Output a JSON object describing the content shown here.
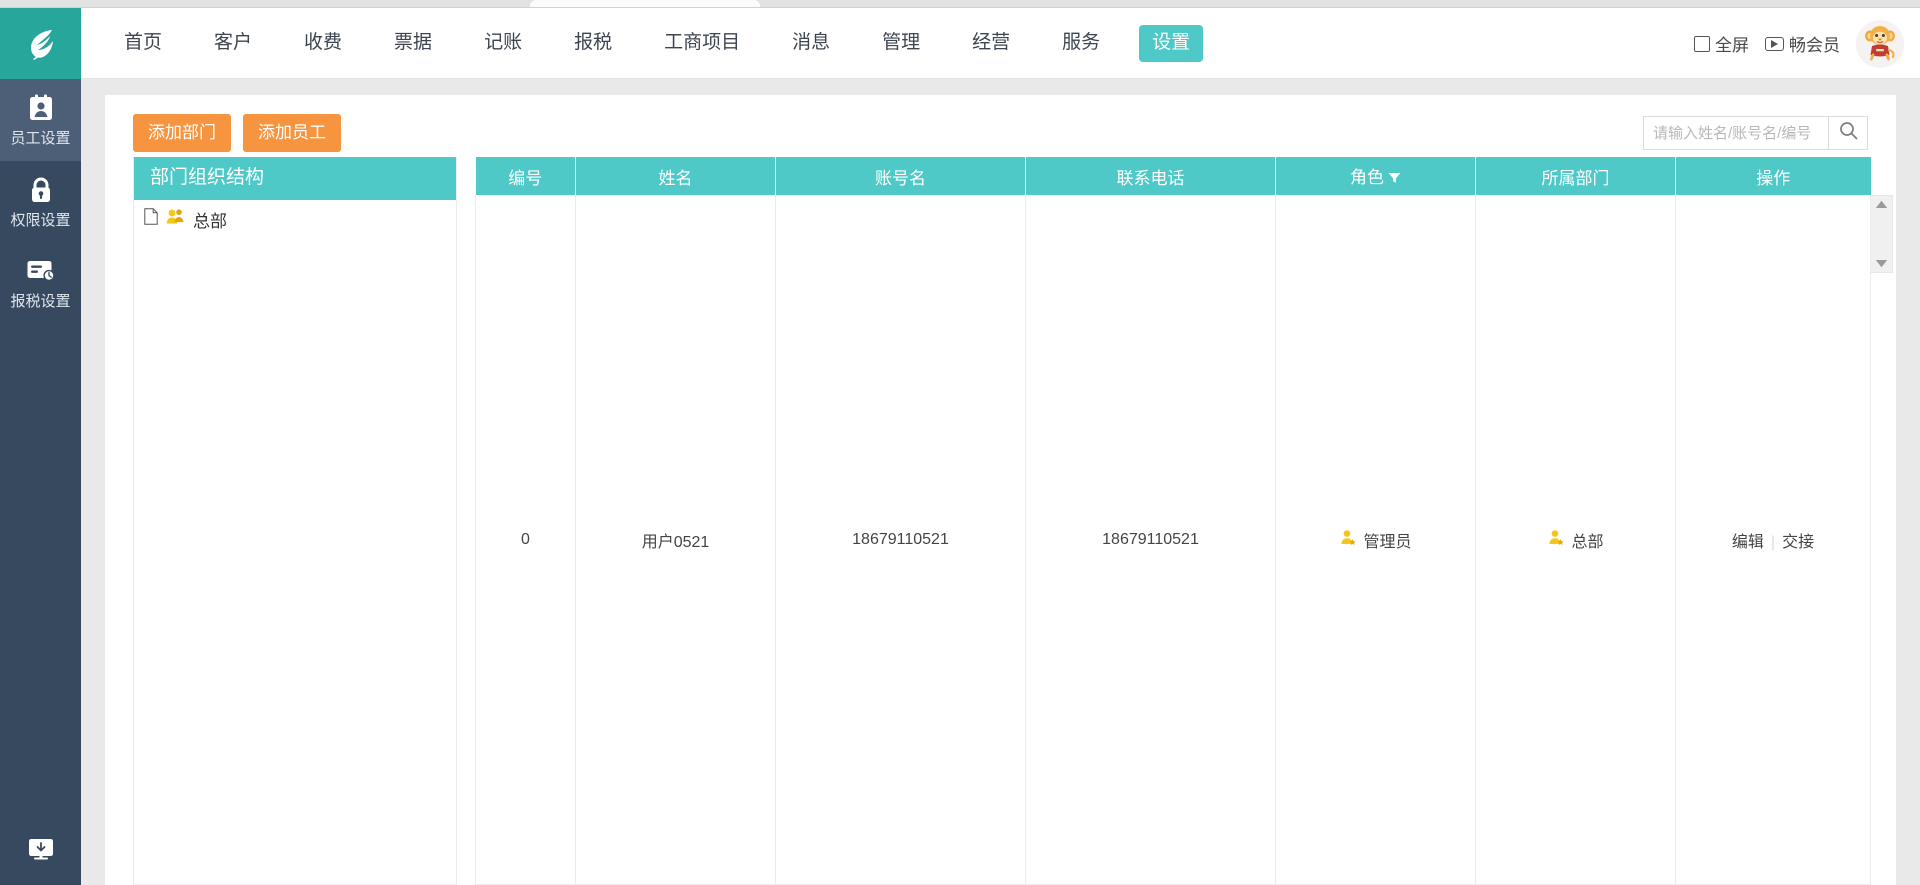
{
  "app": {
    "logo_icon": "feather-logo-icon",
    "brand_color": "#27a79b",
    "accent_teal": "#4fc8c8",
    "accent_orange": "#f6943f",
    "rail_color": "#36495e"
  },
  "header": {
    "nav": [
      {
        "label": "首页",
        "active": false
      },
      {
        "label": "客户",
        "active": false
      },
      {
        "label": "收费",
        "active": false
      },
      {
        "label": "票据",
        "active": false
      },
      {
        "label": "记账",
        "active": false
      },
      {
        "label": "报税",
        "active": false
      },
      {
        "label": "工商项目",
        "active": false
      },
      {
        "label": "消息",
        "active": false
      },
      {
        "label": "管理",
        "active": false
      },
      {
        "label": "经营",
        "active": false
      },
      {
        "label": "服务",
        "active": false
      },
      {
        "label": "设置",
        "active": true
      }
    ],
    "fullscreen_label": "全屏",
    "fullscreen_icon": "fullscreen-icon",
    "member_label": "畅会员",
    "member_icon": "play-icon",
    "avatar_icon": "monkey-avatar-icon"
  },
  "sidebar": {
    "items": [
      {
        "label": "员工设置",
        "icon": "id-badge-icon",
        "active": true
      },
      {
        "label": "权限设置",
        "icon": "lock-icon",
        "active": false
      },
      {
        "label": "报税设置",
        "icon": "tax-card-icon",
        "active": false
      }
    ],
    "bottom_icon": "monitor-download-icon"
  },
  "toolbar": {
    "add_department_label": "添加部门",
    "add_employee_label": "添加员工"
  },
  "search": {
    "placeholder": "请输入姓名/账号名/编号",
    "value": "",
    "icon": "search-icon"
  },
  "tree": {
    "title": "部门组织结构",
    "nodes": [
      {
        "label": "总部",
        "doc_icon": "document-icon",
        "group_icon": "users-group-icon"
      }
    ]
  },
  "table": {
    "columns": [
      {
        "label": "编号",
        "filter": false
      },
      {
        "label": "姓名",
        "filter": false
      },
      {
        "label": "账号名",
        "filter": false
      },
      {
        "label": "联系电话",
        "filter": false
      },
      {
        "label": "角色",
        "filter": true
      },
      {
        "label": "所属部门",
        "filter": false
      },
      {
        "label": "操作",
        "filter": false
      }
    ],
    "rows": [
      {
        "id": "0",
        "name": "用户0521",
        "account": "18679110521",
        "phone": "18679110521",
        "role": "管理员",
        "role_icon": "user-star-icon",
        "department": "总部",
        "department_icon": "user-star-icon",
        "edit_label": "编辑",
        "handover_label": "交接"
      }
    ],
    "scroll_up_icon": "caret-up-icon",
    "scroll_down_icon": "caret-down-icon"
  }
}
